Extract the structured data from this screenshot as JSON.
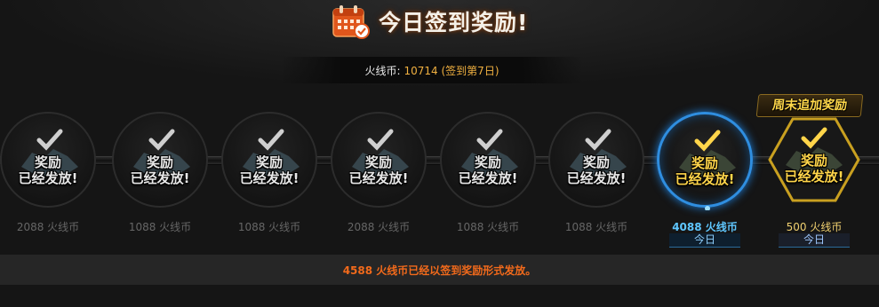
{
  "header": {
    "title": "今日签到奖励!",
    "icon": "calendar-check-icon"
  },
  "coins": {
    "label": "火线币:",
    "value": "10714 (签到第7日)"
  },
  "stamp": {
    "line1": "奖励",
    "line2": "已经发放!"
  },
  "days": [
    {
      "reward": "2088 火线币",
      "state": "claimed"
    },
    {
      "reward": "1088 火线币",
      "state": "claimed"
    },
    {
      "reward": "1088 火线币",
      "state": "claimed"
    },
    {
      "reward": "2088 火线币",
      "state": "claimed"
    },
    {
      "reward": "1088 火线币",
      "state": "claimed"
    },
    {
      "reward": "1088 火线币",
      "state": "claimed"
    },
    {
      "reward": "4088 火线币",
      "state": "today",
      "today_label": "今日"
    },
    {
      "reward": "500 火线币",
      "state": "weekend",
      "today_label": "今日",
      "banner": "周末追加奖励"
    }
  ],
  "footer": {
    "message": "4588 火线币已经以签到奖励形式发放。"
  },
  "colors": {
    "highlight_blue": "#5fc7ff",
    "gold": "#ffd54a",
    "footer_orange": "#f26a1b"
  }
}
